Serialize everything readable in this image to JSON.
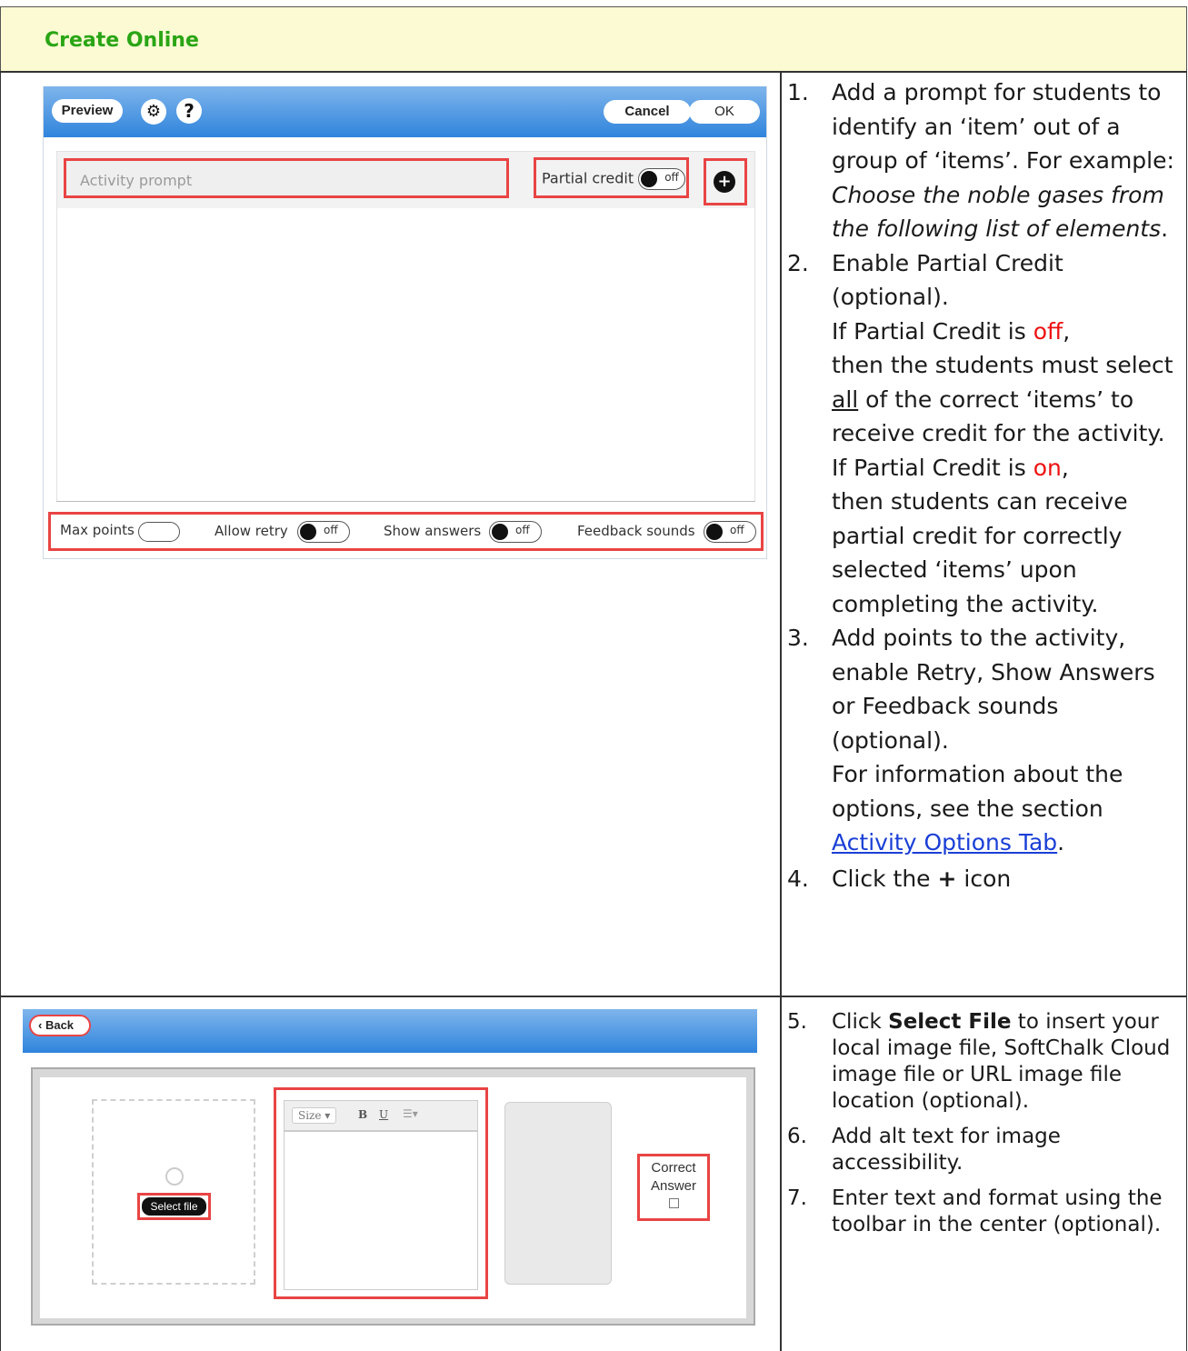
{
  "header": {
    "title": "Create Online"
  },
  "screenshot1": {
    "toolbar": {
      "preview": "Preview",
      "cancel": "Cancel",
      "ok": "OK"
    },
    "prompt_placeholder": "Activity prompt",
    "partial_credit_label": "Partial credit",
    "toggle_off": "off",
    "options": {
      "max_points": "Max points",
      "allow_retry": "Allow retry",
      "show_answers": "Show answers",
      "feedback_sounds": "Feedback sounds"
    }
  },
  "screenshot2": {
    "back": "Back",
    "select_file": "Select file",
    "toolbar": {
      "size": "Size",
      "bold": "B",
      "underline": "U"
    },
    "correct_answer_1": "Correct",
    "correct_answer_2": "Answer"
  },
  "steps1": {
    "s1": {
      "num": "1.",
      "text_a": "Add a prompt for students to identify an ‘item’ out of a group of ‘items’. For example: ",
      "text_italic": "Choose the noble gases from the following list of elements",
      "text_end": "."
    },
    "s2": {
      "num": "2.",
      "line1": "Enable Partial Credit (optional).",
      "p1_a": "If Partial Credit is ",
      "p1_off": "off",
      "p1_b": ",",
      "p1_c": "then the students must select ",
      "p1_all": "all",
      "p1_d": " of the correct ‘items’ to receive credit for the activity.",
      "p2_a": "If Partial Credit is ",
      "p2_on": "on",
      "p2_b": ",",
      "p2_c": "then students can receive partial credit for correctly selected ‘items’ upon completing the activity."
    },
    "s3": {
      "num": "3.",
      "line1": "Add points to the activity, enable Retry, Show Answers or Feedback sounds (optional).",
      "line2": "For information about the options, see the section ",
      "link": "Activity Options Tab",
      "end": "."
    },
    "s4": {
      "num": "4.",
      "a": "Click the ",
      "plus": "+",
      "b": " icon"
    }
  },
  "steps2": {
    "s5": {
      "num": "5.",
      "a": "Click ",
      "bold": "Select File",
      "b": " to insert your local image file, SoftChalk Cloud image file or URL image file location (optional)."
    },
    "s6": {
      "num": "6.",
      "text": "Add alt text for image accessibility."
    },
    "s7": {
      "num": "7.",
      "text": "Enter text and format using the toolbar in the center (optional)."
    }
  }
}
